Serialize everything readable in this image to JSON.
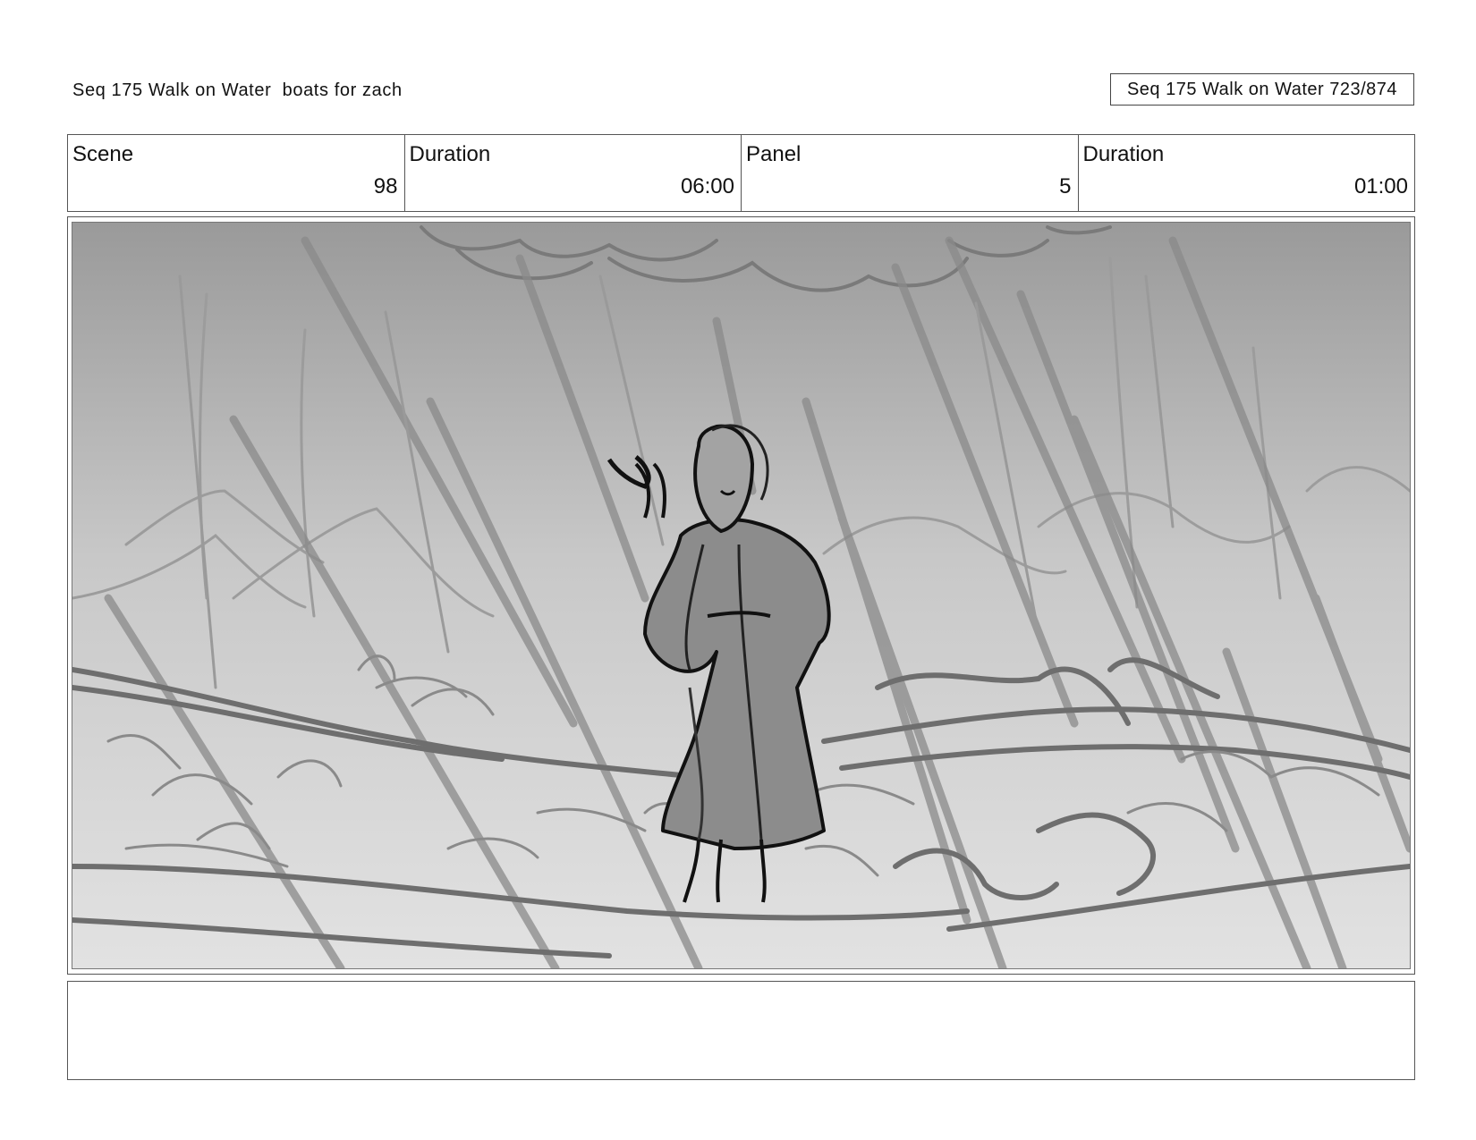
{
  "header": {
    "left_title": "Seq 175 Walk on Water  boats for zach",
    "right_title": "Seq 175 Walk on Water 723/874"
  },
  "info": {
    "scene_label": "Scene",
    "scene_value": "98",
    "duration_label": "Duration",
    "duration_value": "06:00",
    "panel_label": "Panel",
    "panel_value": "5",
    "panel_duration_label": "Duration",
    "panel_duration_value": "01:00"
  },
  "panel": {
    "description": ""
  },
  "caption": {
    "text": ""
  }
}
